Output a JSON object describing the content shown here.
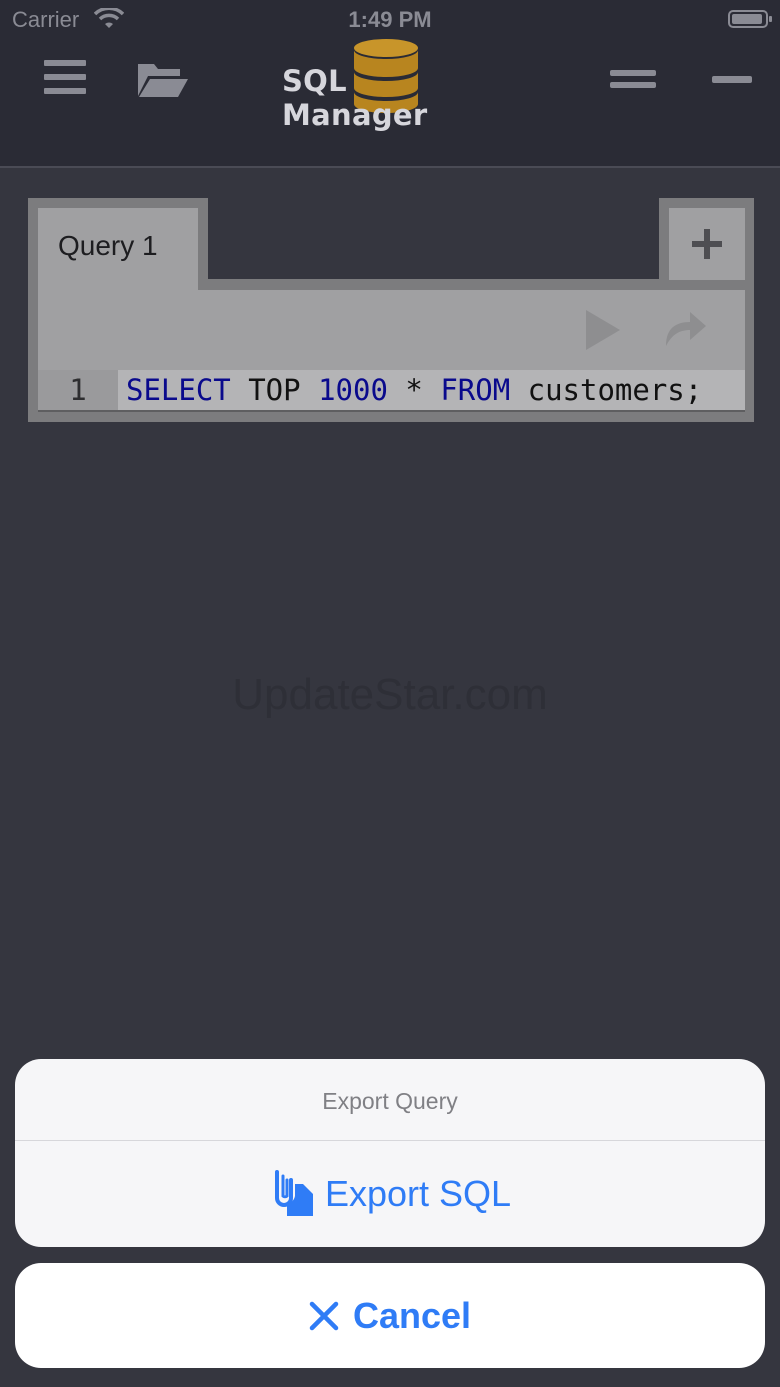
{
  "status_bar": {
    "carrier": "Carrier",
    "time": "1:49 PM"
  },
  "header": {
    "title": "SQL Manager",
    "icons": [
      "menu-icon",
      "folder-open-icon",
      "database-icon",
      "equal-icon",
      "minus-icon"
    ]
  },
  "query": {
    "tab_label": "Query 1",
    "add_tab_icon": "plus-icon",
    "toolbar_icons": [
      "play-icon",
      "redo-icon"
    ],
    "line_number": "1",
    "code_tokens": [
      {
        "text": "SELECT",
        "keyword": true
      },
      {
        "text": " TOP ",
        "keyword": false
      },
      {
        "text": "1000",
        "keyword": true
      },
      {
        "text": " * ",
        "keyword": false
      },
      {
        "text": "FROM",
        "keyword": true
      },
      {
        "text": " customers;",
        "keyword": false
      }
    ]
  },
  "watermark": "UpdateStar.com",
  "action_sheet": {
    "title": "Export Query",
    "export_label": "Export SQL",
    "export_icon": "export-file-icon",
    "cancel_label": "Cancel",
    "cancel_icon": "close-icon"
  },
  "colors": {
    "accent": "#2f7cf6",
    "background": "#35363f",
    "header": "#2a2b35",
    "sql_keyword": "#0a0a8c"
  }
}
